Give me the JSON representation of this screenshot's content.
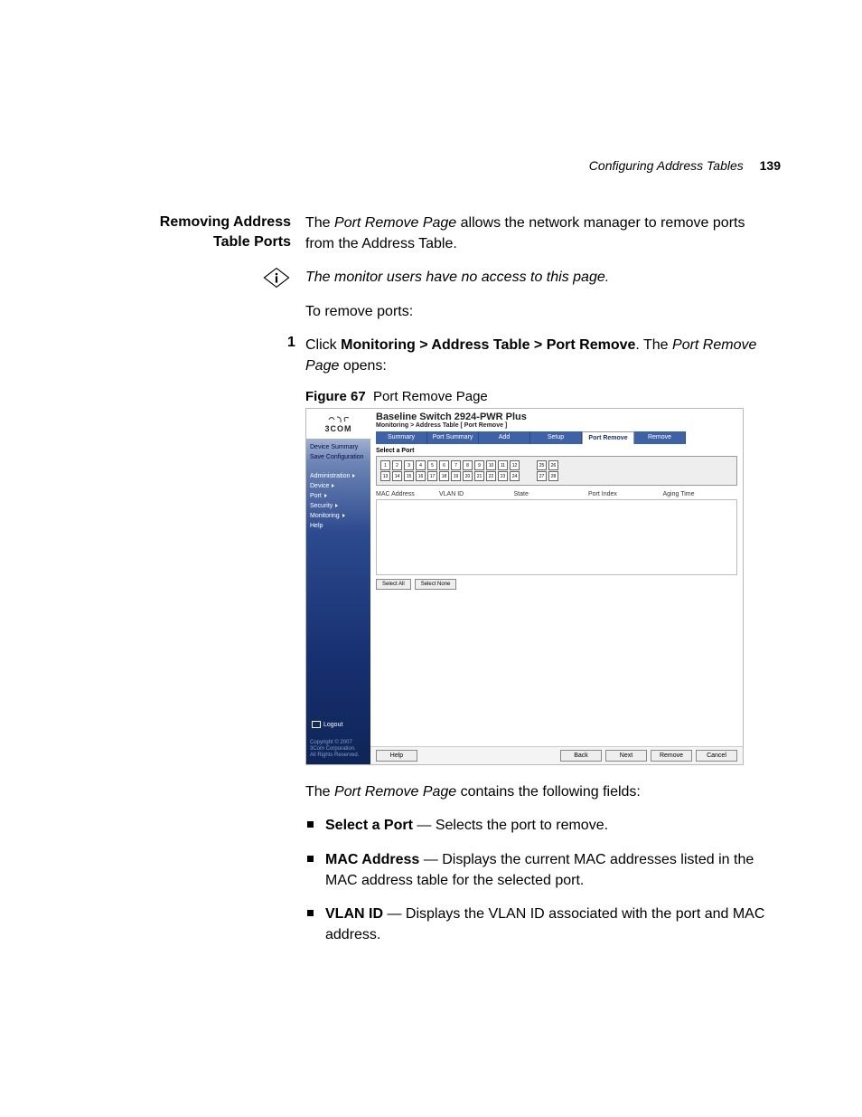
{
  "header": {
    "running": "Configuring Address Tables",
    "page_number": "139"
  },
  "section": {
    "title_l1": "Removing Address",
    "title_l2": "Table Ports"
  },
  "body": {
    "intro_a": "The ",
    "intro_em": "Port Remove Page",
    "intro_b": " allows the network manager to remove ports from the Address Table.",
    "note": "The monitor users have no access to this page.",
    "to_remove": "To remove ports:",
    "step1_a": "Click ",
    "step1_b": "Monitoring > Address Table > Port Remove",
    "step1_c": ". The ",
    "step1_em": "Port Remove Page",
    "step1_d": " opens:",
    "fig_label": "Figure 67",
    "fig_title": "Port Remove Page",
    "after_fig_a": "The ",
    "after_fig_em": "Port Remove Page",
    "after_fig_b": " contains the following fields:"
  },
  "fields": [
    {
      "term": "Select a Port",
      "desc": " — Selects the port to remove."
    },
    {
      "term": "MAC Address",
      "desc": " — Displays the current MAC addresses listed in the MAC address table for the selected port."
    },
    {
      "term": "VLAN ID",
      "desc": " — Displays the VLAN ID associated with the port and MAC address."
    }
  ],
  "shot": {
    "logo": "3COM",
    "device_title": "Baseline Switch 2924-PWR Plus",
    "breadcrumb": "Monitoring > Address Table [ Port Remove ]",
    "side": {
      "device_summary": "Device Summary",
      "save_config": "Save Configuration",
      "administration": "Administration",
      "device": "Device",
      "port": "Port",
      "security": "Security",
      "monitoring": "Monitoring",
      "help": "Help",
      "logout": "Logout",
      "copyright1": "Copyright © 2007",
      "copyright2": "3Com Corporation.",
      "copyright3": "All Rights Reserved."
    },
    "tabs": {
      "summary": "Summary",
      "port_summary": "Port Summary",
      "add": "Add",
      "setup": "Setup",
      "port_remove": "Port Remove",
      "remove": "Remove"
    },
    "panel_label": "Select a Port",
    "ports_row1": [
      "1",
      "2",
      "3",
      "4",
      "5",
      "6",
      "7",
      "8",
      "9",
      "10",
      "11",
      "12"
    ],
    "ports_row2": [
      "13",
      "14",
      "15",
      "16",
      "17",
      "18",
      "19",
      "20",
      "21",
      "22",
      "23",
      "24"
    ],
    "ports_ext1": [
      "25",
      "26"
    ],
    "ports_ext2": [
      "27",
      "28"
    ],
    "cols": {
      "mac": "MAC Address",
      "vlan": "VLAN ID",
      "state": "State",
      "port_index": "Port Index",
      "aging": "Aging Time"
    },
    "buttons": {
      "select_all": "Select All",
      "select_none": "Select None",
      "help": "Help",
      "back": "Back",
      "next": "Next",
      "remove": "Remove",
      "cancel": "Cancel"
    }
  }
}
